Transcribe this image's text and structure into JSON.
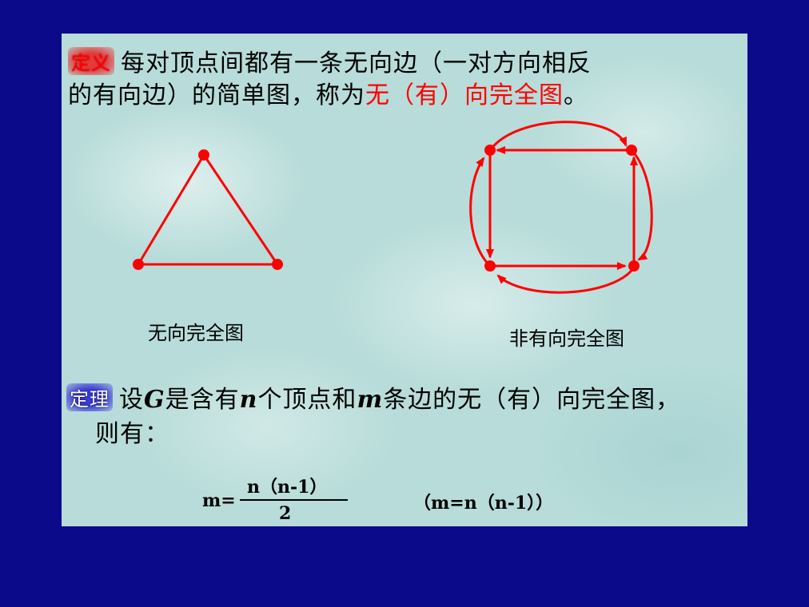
{
  "definition": {
    "badge": "定义",
    "line1": "每对顶点间都有一条无向边（一对方向相反",
    "line2_prefix": "的有向边）的简单图，称为",
    "line2_highlight": "无（有）向完全图",
    "line2_suffix": "。"
  },
  "figures": {
    "left_caption": "无向完全图",
    "right_caption": "非有向完全图",
    "colors": {
      "edge": "#ff0000",
      "vertex": "#ff0000"
    }
  },
  "theorem": {
    "badge": "定理",
    "part1": "设",
    "G": "G",
    "part2": "是含有",
    "n": "n",
    "part3": "个顶点和",
    "m": "m",
    "part4": "条边的无（有）向完全图，",
    "line2": "则有："
  },
  "formula": {
    "lhs": "m=",
    "numerator": "n（n-1）",
    "denominator": "2",
    "alt": "（m=n（n-1））"
  },
  "colors": {
    "background": "#0a0a8a",
    "slide": "#b7dcd9",
    "highlight": "#ff0000"
  }
}
